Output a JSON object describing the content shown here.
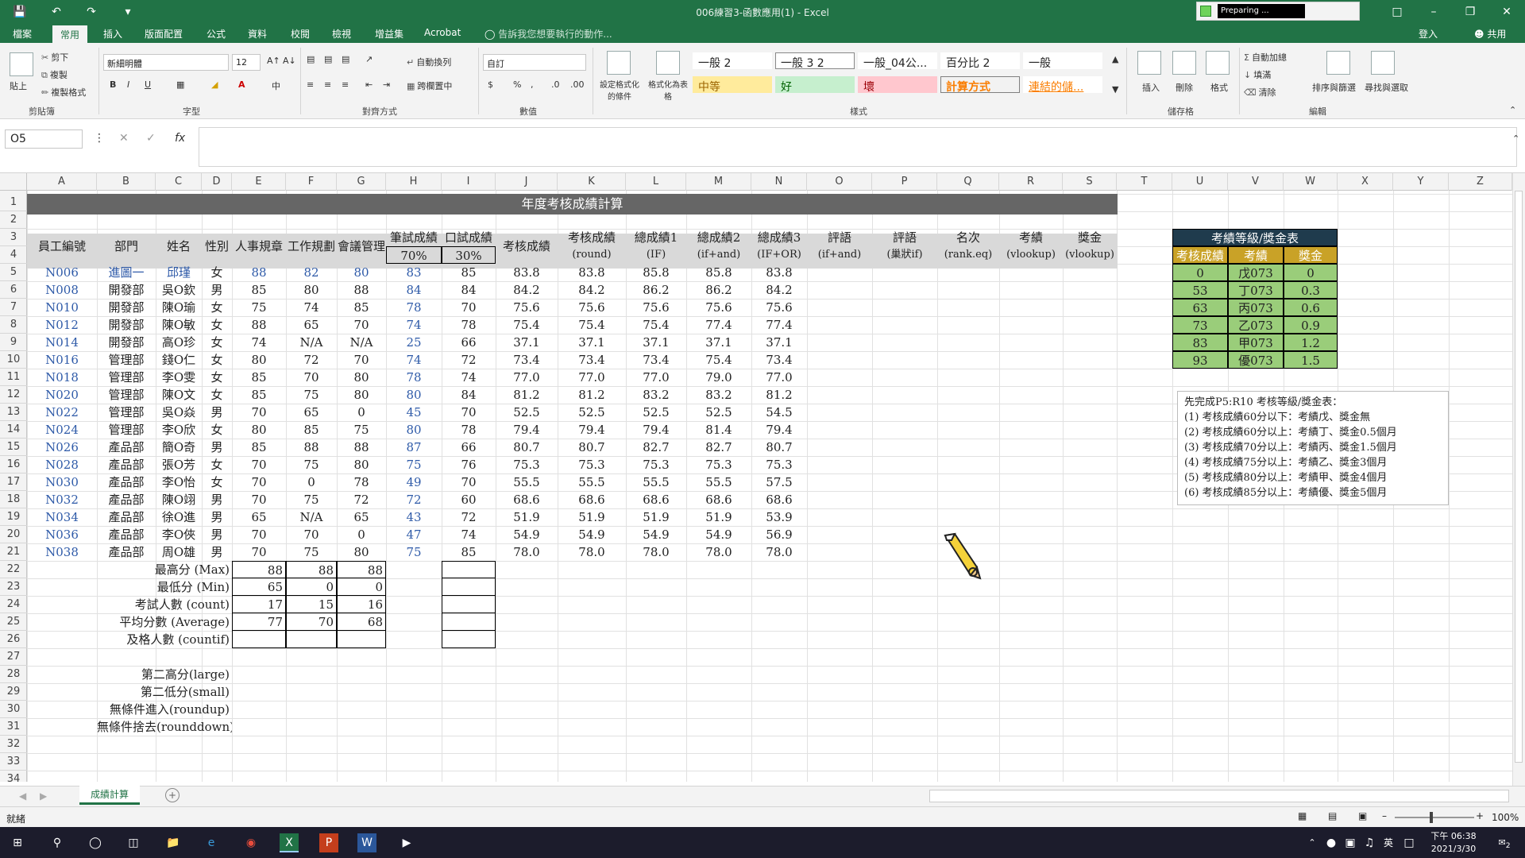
{
  "window": {
    "title": "006練習3-函數應用(1) - Excel",
    "preparing": "Preparing ..."
  },
  "ribbon_tabs": [
    "檔案",
    "常用",
    "插入",
    "版面配置",
    "公式",
    "資料",
    "校閱",
    "檢視",
    "增益集",
    "Acrobat"
  ],
  "tell_me": "告訴我您想要執行的動作...",
  "signin": "登入",
  "share": "共用",
  "clipboard": {
    "paste": "貼上",
    "cut": "剪下",
    "copy": "複製",
    "format_painter": "複製格式",
    "label": "剪貼簿"
  },
  "font": {
    "name": "新細明體",
    "size": "12",
    "label": "字型"
  },
  "alignment": {
    "wrap": "自動換列",
    "merge": "跨欄置中",
    "label": "對齊方式"
  },
  "number": {
    "format": "自訂",
    "label": "數值"
  },
  "styles": {
    "cond_format": "設定格式化的條件",
    "table_format": "格式化為表格",
    "gallery_row1": [
      "一般 2",
      "一般 3 2",
      "一般_04公...",
      "百分比 2",
      "一般"
    ],
    "gallery_row2": [
      "中等",
      "好",
      "壞",
      "計算方式",
      "連結的儲..."
    ],
    "label": "樣式"
  },
  "cells": {
    "insert": "插入",
    "delete": "刪除",
    "format": "格式",
    "label": "儲存格"
  },
  "editing": {
    "autosum": "自動加總",
    "fill": "填滿",
    "clear": "清除",
    "sort": "排序與篩選",
    "find": "尋找與選取",
    "label": "編輯"
  },
  "name_box": "O5",
  "formula": "",
  "columns": [
    "A",
    "B",
    "C",
    "D",
    "E",
    "F",
    "G",
    "H",
    "I",
    "J",
    "K",
    "L",
    "M",
    "N",
    "O",
    "P",
    "Q",
    "R",
    "S",
    "T",
    "U",
    "V",
    "W",
    "X",
    "Y",
    "Z"
  ],
  "rows": [
    "1",
    "2",
    "3",
    "4",
    "5",
    "6",
    "7",
    "8",
    "9",
    "10",
    "11",
    "12",
    "13",
    "14",
    "15",
    "16",
    "17",
    "18",
    "19",
    "20",
    "21",
    "22",
    "23",
    "24",
    "25",
    "26",
    "27",
    "28",
    "29",
    "30",
    "31",
    "32",
    "33",
    "34"
  ],
  "sheet_title": "年度考核成績計算",
  "headers": {
    "emp_id": "員工編號",
    "dept": "部門",
    "name": "姓名",
    "gender": "性別",
    "hr": "人事規章",
    "work": "工作規劃",
    "meeting": "會議管理",
    "written": "筆試成績",
    "written_pct": "70%",
    "oral": "口試成績",
    "oral_pct": "30%",
    "score": "考核成績",
    "round": "考核成績",
    "round_sub": "(round)",
    "total1": "總成績1",
    "total1_sub": "(IF)",
    "total2": "總成績2",
    "total2_sub": "(if+and)",
    "total3": "總成績3",
    "total3_sub": "(IF+OR)",
    "comment1": "評語",
    "comment1_sub": "(if+and)",
    "comment2": "評語",
    "comment2_sub": "(巢狀if)",
    "rank": "名次",
    "rank_sub": "(rank.eq)",
    "grade": "考績",
    "grade_sub": "(vlookup)",
    "bonus": "獎金",
    "bonus_sub": "(vlookup)"
  },
  "data_rows": [
    [
      "N006",
      "進圖一",
      "邱瑾",
      "女",
      "88",
      "82",
      "80",
      "83",
      "85",
      "83.8",
      "83.8",
      "85.8",
      "85.8",
      "83.8"
    ],
    [
      "N008",
      "開發部",
      "吳O欽",
      "男",
      "85",
      "80",
      "88",
      "84",
      "84",
      "84.2",
      "84.2",
      "86.2",
      "86.2",
      "84.2"
    ],
    [
      "N010",
      "開發部",
      "陳O瑜",
      "女",
      "75",
      "74",
      "85",
      "78",
      "70",
      "75.6",
      "75.6",
      "75.6",
      "75.6",
      "75.6"
    ],
    [
      "N012",
      "開發部",
      "陳O敏",
      "女",
      "88",
      "65",
      "70",
      "74",
      "78",
      "75.4",
      "75.4",
      "75.4",
      "77.4",
      "77.4"
    ],
    [
      "N014",
      "開發部",
      "高O珍",
      "女",
      "74",
      "N/A",
      "N/A",
      "25",
      "66",
      "37.1",
      "37.1",
      "37.1",
      "37.1",
      "37.1"
    ],
    [
      "N016",
      "管理部",
      "錢O仁",
      "女",
      "80",
      "72",
      "70",
      "74",
      "72",
      "73.4",
      "73.4",
      "73.4",
      "75.4",
      "73.4"
    ],
    [
      "N018",
      "管理部",
      "李O雯",
      "女",
      "85",
      "70",
      "80",
      "78",
      "74",
      "77.0",
      "77.0",
      "77.0",
      "79.0",
      "77.0"
    ],
    [
      "N020",
      "管理部",
      "陳O文",
      "女",
      "85",
      "75",
      "80",
      "80",
      "84",
      "81.2",
      "81.2",
      "83.2",
      "83.2",
      "81.2"
    ],
    [
      "N022",
      "管理部",
      "吳O焱",
      "男",
      "70",
      "65",
      "0",
      "45",
      "70",
      "52.5",
      "52.5",
      "52.5",
      "52.5",
      "54.5"
    ],
    [
      "N024",
      "管理部",
      "李O欣",
      "女",
      "80",
      "85",
      "75",
      "80",
      "78",
      "79.4",
      "79.4",
      "79.4",
      "81.4",
      "79.4"
    ],
    [
      "N026",
      "產品部",
      "簡O奇",
      "男",
      "85",
      "88",
      "88",
      "87",
      "66",
      "80.7",
      "80.7",
      "82.7",
      "82.7",
      "80.7"
    ],
    [
      "N028",
      "產品部",
      "張O芳",
      "女",
      "70",
      "75",
      "80",
      "75",
      "76",
      "75.3",
      "75.3",
      "75.3",
      "75.3",
      "75.3"
    ],
    [
      "N030",
      "產品部",
      "李O怡",
      "女",
      "70",
      "0",
      "78",
      "49",
      "70",
      "55.5",
      "55.5",
      "55.5",
      "55.5",
      "57.5"
    ],
    [
      "N032",
      "產品部",
      "陳O翊",
      "男",
      "70",
      "75",
      "72",
      "72",
      "60",
      "68.6",
      "68.6",
      "68.6",
      "68.6",
      "68.6"
    ],
    [
      "N034",
      "產品部",
      "徐O進",
      "男",
      "65",
      "N/A",
      "65",
      "43",
      "72",
      "51.9",
      "51.9",
      "51.9",
      "51.9",
      "53.9"
    ],
    [
      "N036",
      "產品部",
      "李O俠",
      "男",
      "70",
      "70",
      "0",
      "47",
      "74",
      "54.9",
      "54.9",
      "54.9",
      "54.9",
      "56.9"
    ],
    [
      "N038",
      "產品部",
      "周O雄",
      "男",
      "70",
      "75",
      "80",
      "75",
      "85",
      "78.0",
      "78.0",
      "78.0",
      "78.0",
      "78.0"
    ]
  ],
  "stats": [
    {
      "label": "最高分 (Max)",
      "e": "88",
      "f": "88",
      "g": "88"
    },
    {
      "label": "最低分 (Min)",
      "e": "65",
      "f": "0",
      "g": "0"
    },
    {
      "label": "考試人數 (count)",
      "e": "17",
      "f": "15",
      "g": "16"
    },
    {
      "label": "平均分數 (Average)",
      "e": "77",
      "f": "70",
      "g": "68"
    },
    {
      "label": "及格人數 (countif)",
      "e": "",
      "f": "",
      "g": ""
    }
  ],
  "extra_labels": [
    "第二高分(large)",
    "第二低分(small)",
    "無條件進入(roundup)",
    "無條件捨去(rounddown)"
  ],
  "bonus_table": {
    "title": "考績等級/獎金表",
    "headers": [
      "考核成績",
      "考績",
      "獎金"
    ],
    "rows": [
      [
        "0",
        "戊073",
        "0"
      ],
      [
        "53",
        "丁073",
        "0.3"
      ],
      [
        "63",
        "丙073",
        "0.6"
      ],
      [
        "73",
        "乙073",
        "0.9"
      ],
      [
        "83",
        "甲073",
        "1.2"
      ],
      [
        "93",
        "優073",
        "1.5"
      ]
    ]
  },
  "note": {
    "lines": [
      "先完成P5:R10 考核等級/獎金表：",
      "(1) 考核成績60分以下：考績戊、獎金無",
      "(2) 考核成績60分以上：考績丁、獎金0.5個月",
      "(3) 考核成績70分以上：考績丙、獎金1.5個月",
      "(4) 考核成績75分以上：考績乙、獎金3個月",
      "(5) 考核成績80分以上：考績甲、獎金4個月",
      "(6) 考核成績85分以上：考績優、獎金5個月"
    ]
  },
  "sheet_tab": "成績計算",
  "status": {
    "ready": "就緒",
    "zoom": "100%"
  },
  "clock": {
    "time": "下午 06:38",
    "date": "2021/3/30"
  },
  "ime": "英",
  "notify_count": "2",
  "colors": {
    "excel_green": "#217346",
    "header_gray": "#666666",
    "bonus_dark": "#1f3b4d",
    "bonus_gold": "#c9a227",
    "bonus_green": "#9acd7a"
  }
}
